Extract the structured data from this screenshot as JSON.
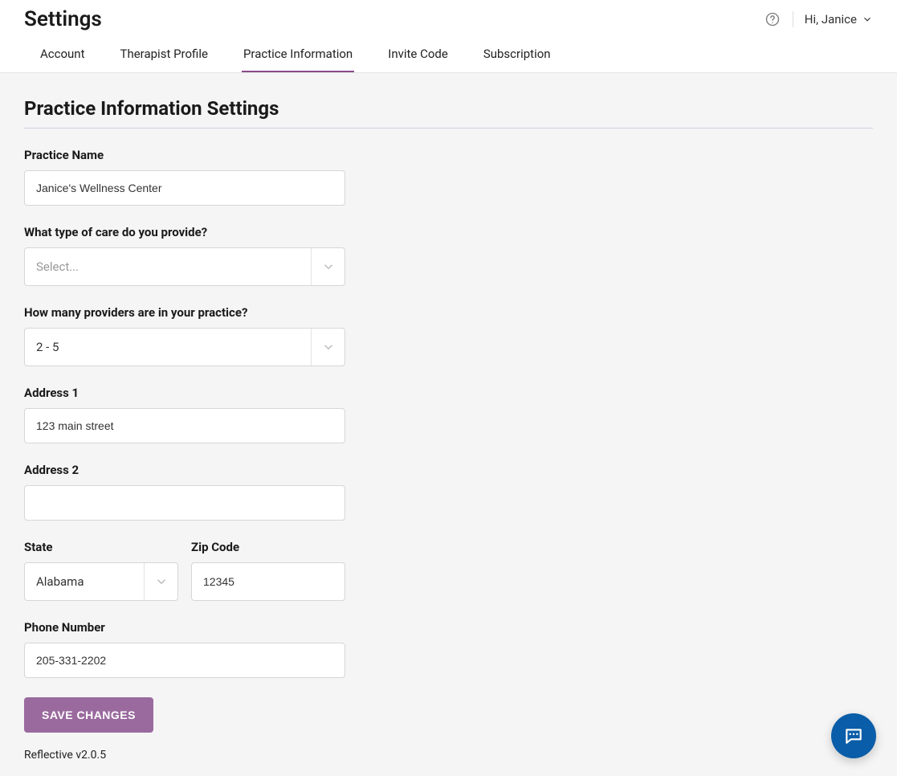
{
  "header": {
    "title": "Settings",
    "user_greeting": "Hi, Janice"
  },
  "tabs": [
    {
      "label": "Account",
      "active": false
    },
    {
      "label": "Therapist Profile",
      "active": false
    },
    {
      "label": "Practice Information",
      "active": true
    },
    {
      "label": "Invite Code",
      "active": false
    },
    {
      "label": "Subscription",
      "active": false
    }
  ],
  "section": {
    "title": "Practice Information Settings"
  },
  "form": {
    "practice_name": {
      "label": "Practice Name",
      "value": "Janice's Wellness Center"
    },
    "care_type": {
      "label": "What type of care do you provide?",
      "placeholder": "Select...",
      "value": ""
    },
    "provider_count": {
      "label": "How many providers are in your practice?",
      "value": "2 - 5"
    },
    "address1": {
      "label": "Address 1",
      "value": "123 main street"
    },
    "address2": {
      "label": "Address 2",
      "value": ""
    },
    "state": {
      "label": "State",
      "value": "Alabama"
    },
    "zip": {
      "label": "Zip Code",
      "value": "12345"
    },
    "phone": {
      "label": "Phone Number",
      "value": "205-331-2202"
    },
    "save_label": "SAVE CHANGES"
  },
  "footer": {
    "version": "Reflective v2.0.5"
  }
}
